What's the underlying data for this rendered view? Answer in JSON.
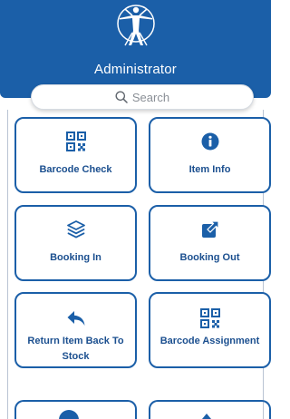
{
  "header": {
    "role": "Administrator",
    "bg_color": "#1b5fa8",
    "logo_icon": "vitruvian-man-logo"
  },
  "search": {
    "placeholder": "Search",
    "icon": "search-icon"
  },
  "tiles": [
    {
      "label": "Barcode Check",
      "icon": "qr-code-icon"
    },
    {
      "label": "Item Info",
      "icon": "info-icon"
    },
    {
      "label": "Booking In",
      "icon": "layers-icon"
    },
    {
      "label": "Booking Out",
      "icon": "external-link-icon"
    },
    {
      "label": "Return Item Back To Stock",
      "icon": "reply-arrow-icon"
    },
    {
      "label": "Barcode Assignment",
      "icon": "qr-code-icon"
    }
  ],
  "accent_color": "#1b5fa8"
}
